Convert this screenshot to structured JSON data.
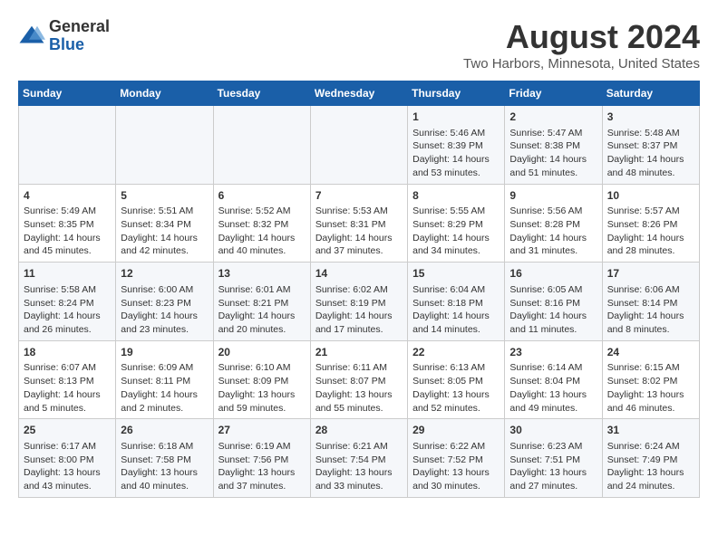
{
  "logo": {
    "general": "General",
    "blue": "Blue"
  },
  "title": "August 2024",
  "subtitle": "Two Harbors, Minnesota, United States",
  "days_of_week": [
    "Sunday",
    "Monday",
    "Tuesday",
    "Wednesday",
    "Thursday",
    "Friday",
    "Saturday"
  ],
  "weeks": [
    [
      {
        "day": "",
        "content": ""
      },
      {
        "day": "",
        "content": ""
      },
      {
        "day": "",
        "content": ""
      },
      {
        "day": "",
        "content": ""
      },
      {
        "day": "1",
        "content": "Sunrise: 5:46 AM\nSunset: 8:39 PM\nDaylight: 14 hours and 53 minutes."
      },
      {
        "day": "2",
        "content": "Sunrise: 5:47 AM\nSunset: 8:38 PM\nDaylight: 14 hours and 51 minutes."
      },
      {
        "day": "3",
        "content": "Sunrise: 5:48 AM\nSunset: 8:37 PM\nDaylight: 14 hours and 48 minutes."
      }
    ],
    [
      {
        "day": "4",
        "content": "Sunrise: 5:49 AM\nSunset: 8:35 PM\nDaylight: 14 hours and 45 minutes."
      },
      {
        "day": "5",
        "content": "Sunrise: 5:51 AM\nSunset: 8:34 PM\nDaylight: 14 hours and 42 minutes."
      },
      {
        "day": "6",
        "content": "Sunrise: 5:52 AM\nSunset: 8:32 PM\nDaylight: 14 hours and 40 minutes."
      },
      {
        "day": "7",
        "content": "Sunrise: 5:53 AM\nSunset: 8:31 PM\nDaylight: 14 hours and 37 minutes."
      },
      {
        "day": "8",
        "content": "Sunrise: 5:55 AM\nSunset: 8:29 PM\nDaylight: 14 hours and 34 minutes."
      },
      {
        "day": "9",
        "content": "Sunrise: 5:56 AM\nSunset: 8:28 PM\nDaylight: 14 hours and 31 minutes."
      },
      {
        "day": "10",
        "content": "Sunrise: 5:57 AM\nSunset: 8:26 PM\nDaylight: 14 hours and 28 minutes."
      }
    ],
    [
      {
        "day": "11",
        "content": "Sunrise: 5:58 AM\nSunset: 8:24 PM\nDaylight: 14 hours and 26 minutes."
      },
      {
        "day": "12",
        "content": "Sunrise: 6:00 AM\nSunset: 8:23 PM\nDaylight: 14 hours and 23 minutes."
      },
      {
        "day": "13",
        "content": "Sunrise: 6:01 AM\nSunset: 8:21 PM\nDaylight: 14 hours and 20 minutes."
      },
      {
        "day": "14",
        "content": "Sunrise: 6:02 AM\nSunset: 8:19 PM\nDaylight: 14 hours and 17 minutes."
      },
      {
        "day": "15",
        "content": "Sunrise: 6:04 AM\nSunset: 8:18 PM\nDaylight: 14 hours and 14 minutes."
      },
      {
        "day": "16",
        "content": "Sunrise: 6:05 AM\nSunset: 8:16 PM\nDaylight: 14 hours and 11 minutes."
      },
      {
        "day": "17",
        "content": "Sunrise: 6:06 AM\nSunset: 8:14 PM\nDaylight: 14 hours and 8 minutes."
      }
    ],
    [
      {
        "day": "18",
        "content": "Sunrise: 6:07 AM\nSunset: 8:13 PM\nDaylight: 14 hours and 5 minutes."
      },
      {
        "day": "19",
        "content": "Sunrise: 6:09 AM\nSunset: 8:11 PM\nDaylight: 14 hours and 2 minutes."
      },
      {
        "day": "20",
        "content": "Sunrise: 6:10 AM\nSunset: 8:09 PM\nDaylight: 13 hours and 59 minutes."
      },
      {
        "day": "21",
        "content": "Sunrise: 6:11 AM\nSunset: 8:07 PM\nDaylight: 13 hours and 55 minutes."
      },
      {
        "day": "22",
        "content": "Sunrise: 6:13 AM\nSunset: 8:05 PM\nDaylight: 13 hours and 52 minutes."
      },
      {
        "day": "23",
        "content": "Sunrise: 6:14 AM\nSunset: 8:04 PM\nDaylight: 13 hours and 49 minutes."
      },
      {
        "day": "24",
        "content": "Sunrise: 6:15 AM\nSunset: 8:02 PM\nDaylight: 13 hours and 46 minutes."
      }
    ],
    [
      {
        "day": "25",
        "content": "Sunrise: 6:17 AM\nSunset: 8:00 PM\nDaylight: 13 hours and 43 minutes."
      },
      {
        "day": "26",
        "content": "Sunrise: 6:18 AM\nSunset: 7:58 PM\nDaylight: 13 hours and 40 minutes."
      },
      {
        "day": "27",
        "content": "Sunrise: 6:19 AM\nSunset: 7:56 PM\nDaylight: 13 hours and 37 minutes."
      },
      {
        "day": "28",
        "content": "Sunrise: 6:21 AM\nSunset: 7:54 PM\nDaylight: 13 hours and 33 minutes."
      },
      {
        "day": "29",
        "content": "Sunrise: 6:22 AM\nSunset: 7:52 PM\nDaylight: 13 hours and 30 minutes."
      },
      {
        "day": "30",
        "content": "Sunrise: 6:23 AM\nSunset: 7:51 PM\nDaylight: 13 hours and 27 minutes."
      },
      {
        "day": "31",
        "content": "Sunrise: 6:24 AM\nSunset: 7:49 PM\nDaylight: 13 hours and 24 minutes."
      }
    ]
  ]
}
